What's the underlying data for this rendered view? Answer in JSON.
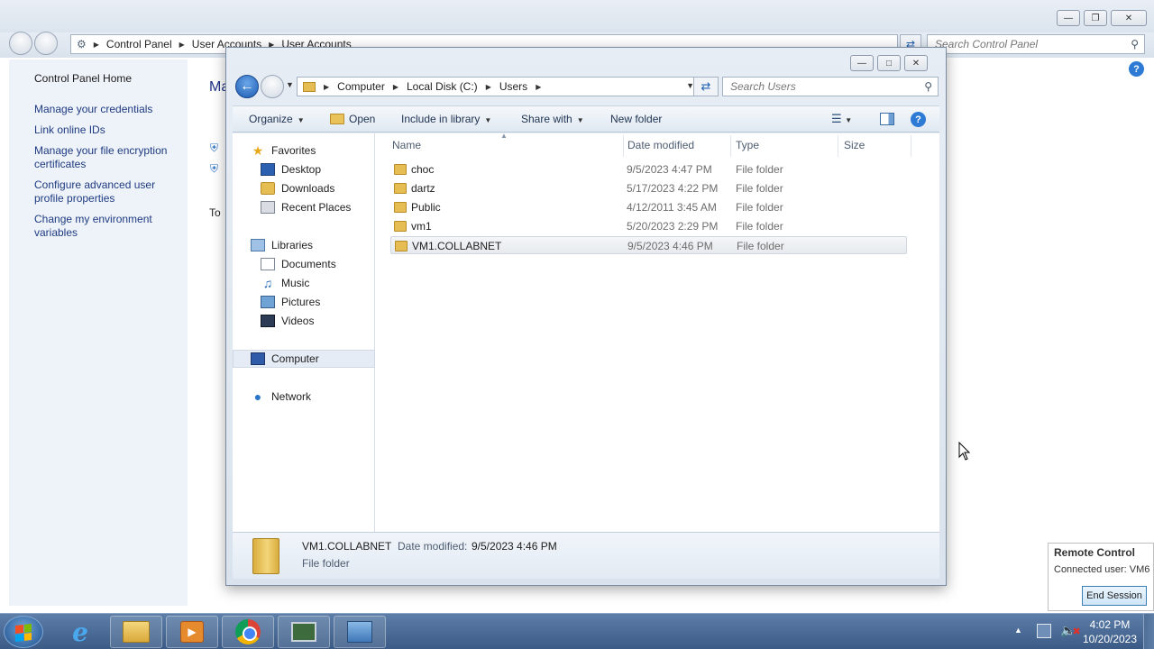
{
  "control_panel": {
    "breadcrumb": [
      "Control Panel",
      "User Accounts",
      "User Accounts"
    ],
    "search_placeholder": "Search Control Panel",
    "sidebar_home": "Control Panel Home",
    "tasks": [
      "Manage your credentials",
      "Link online IDs",
      "Manage your file encryption certificates",
      "Configure advanced user profile properties",
      "Change my environment variables"
    ],
    "main_heading_stub": "Ma",
    "main_text_stub": "To"
  },
  "explorer": {
    "breadcrumb": [
      "Computer",
      "Local Disk (C:)",
      "Users"
    ],
    "search_placeholder": "Search Users",
    "toolbar": {
      "organize": "Organize",
      "open": "Open",
      "include_in_library": "Include in library",
      "share_with": "Share with",
      "new_folder": "New folder"
    },
    "nav": {
      "favorites": "Favorites",
      "desktop": "Desktop",
      "downloads": "Downloads",
      "recent_places": "Recent Places",
      "libraries": "Libraries",
      "documents": "Documents",
      "music": "Music",
      "pictures": "Pictures",
      "videos": "Videos",
      "computer": "Computer",
      "network": "Network"
    },
    "columns": [
      "Name",
      "Date modified",
      "Type",
      "Size"
    ],
    "files": [
      {
        "name": "choc",
        "date": "9/5/2023 4:47 PM",
        "type": "File folder"
      },
      {
        "name": "dartz",
        "date": "5/17/2023 4:22 PM",
        "type": "File folder"
      },
      {
        "name": "Public",
        "date": "4/12/2011 3:45 AM",
        "type": "File folder"
      },
      {
        "name": "vm1",
        "date": "5/20/2023 2:29 PM",
        "type": "File folder"
      },
      {
        "name": "VM1.COLLABNET",
        "date": "9/5/2023 4:46 PM",
        "type": "File folder"
      }
    ],
    "details": {
      "name": "VM1.COLLABNET",
      "date_label": "Date modified:",
      "date": "9/5/2023 4:46 PM",
      "type": "File folder"
    }
  },
  "remote_control": {
    "title": "Remote Control",
    "connected_user": "Connected user:  VM6",
    "end_session": "End Session"
  },
  "taskbar": {
    "time": "4:02 PM",
    "date": "10/20/2023"
  }
}
